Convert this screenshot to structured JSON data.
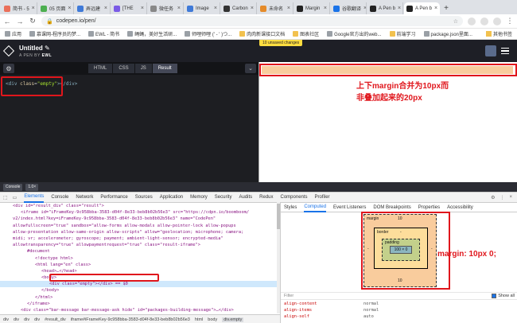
{
  "browser": {
    "tabs": [
      {
        "title": "简书 - 5",
        "color": "#ea6f5a",
        "active": false
      },
      {
        "title": "05 页面",
        "color": "#4caf50",
        "active": false
      },
      {
        "title": "弄远建",
        "color": "#3f7ad8",
        "active": false
      },
      {
        "title": "[THE",
        "color": "#7b5be6",
        "active": false
      },
      {
        "title": "微任务",
        "color": "#888888",
        "active": false
      },
      {
        "title": "Image",
        "color": "#3f7ad8",
        "active": false
      },
      {
        "title": "Carbon",
        "color": "#333333",
        "active": false
      },
      {
        "title": "未命名",
        "color": "#e58b2a",
        "active": false
      },
      {
        "title": "Margin",
        "color": "#222222",
        "active": false
      },
      {
        "title": "谷歌翻译",
        "color": "#1a73e8",
        "active": false
      },
      {
        "title": "A Pen b",
        "color": "#222222",
        "active": false
      },
      {
        "title": "A Pen b",
        "color": "#222222",
        "active": true
      }
    ],
    "url": "codepen.io/pen/",
    "bookmarks": [
      {
        "label": "应用",
        "folder": false
      },
      {
        "label": "慕课网-程序员的梦...",
        "folder": false
      },
      {
        "label": "EWL - 简书",
        "folder": false
      },
      {
        "label": "绳蝇，美好生活研...",
        "folder": false
      },
      {
        "label": "师哩师哩 (' - ' )つ...",
        "folder": false
      },
      {
        "label": "肉肉新课接口文档",
        "folder": true
      },
      {
        "label": "图表社区",
        "folder": true
      },
      {
        "label": "Google官方出的web...",
        "folder": false
      },
      {
        "label": "前端学习",
        "folder": true
      },
      {
        "label": "package.json里面...",
        "folder": false
      }
    ],
    "other_bookmarks": "其他书签"
  },
  "codepen": {
    "title": "Untitled",
    "byline_prefix": "A PEN BY",
    "author": "EWL",
    "unsaved": "10 unsaved changes",
    "tabs": [
      "HTML",
      "CSS",
      "JS",
      "Result"
    ],
    "code": {
      "tag": "div",
      "attr": "class",
      "value": "\"empty\""
    },
    "annotation_line1": "上下margin合并为10px而",
    "annotation_line2": "非叠加起来的20px"
  },
  "drawer": {
    "console": "Console",
    "version": "1.0×"
  },
  "devtools": {
    "tabs": [
      "Elements",
      "Console",
      "Network",
      "Performance",
      "Sources",
      "Application",
      "Memory",
      "Security",
      "Audits",
      "Redux",
      "Components",
      "Profiler"
    ],
    "active_tab": "Elements",
    "side_tabs": [
      "Styles",
      "Computed",
      "Event Listeners",
      "DOM Breakpoints",
      "Properties",
      "Accessibility"
    ],
    "active_side_tab": "Computed",
    "breadcrumb": [
      "div",
      "div",
      "div",
      "div",
      "#result_div",
      "iframe#iFrameKey-9c958bba-3583-d04f-8e33-beb8b02b56e3",
      "html",
      "body",
      "div.empty"
    ],
    "box_model": {
      "margin_label": "margin",
      "margin_top": "10",
      "margin_bottom": "10",
      "margin_left": "-",
      "margin_right": "-",
      "border_label": "border",
      "border_value": "-",
      "padding_label": "padding",
      "padding_value": "-",
      "content": "100 × 0"
    },
    "margin_note": "margin: 10px 0;",
    "filter_placeholder": "Filter",
    "show_all": "Show all",
    "computed": [
      {
        "name": "align-content",
        "value": "normal"
      },
      {
        "name": "align-items",
        "value": "normal"
      },
      {
        "name": "align-self",
        "value": "auto"
      }
    ],
    "elements_lines": [
      "<div id=\"result_div\" class=\"result\">",
      "<iframe id=\"iFrameKey-9c958bba-3583-d04f-8e33-beb8b02b56e3\" src=\"https://cdpn.io/boomboom/",
      "v2/index.html?key=iFrameKey-9c958bba-3583-d04f-8e33-beb8b02b56e3\" name=\"CodePen\"",
      "allowfullscreen=\"true\" sandbox=\"allow-forms allow-modals allow-pointer-lock allow-popups",
      "allow-presentation allow-same-origin allow-scripts\" allow=\"geolocation; microphone; camera;",
      "midi; vr; accelerometer; gyroscope; payment; ambient-light-sensor; encrypted-media\"",
      "allowtransparency=\"true\" allowpaymentrequest=\"true\" class=\"result-iframe\">",
      "#document",
      "<!doctype html>",
      "<html lang=\"en\" class>",
      "<head>…</head>",
      "<body>",
      "<div class=\"empty\"></div> == $0",
      "</body>",
      "</html>",
      "</iframe>",
      "<div class=\"bar-message bar-message-ask hide\" id=\"packages-building-message\">…</div>",
      "<div id=\"asset-bin-goes-here\"></div>"
    ]
  }
}
